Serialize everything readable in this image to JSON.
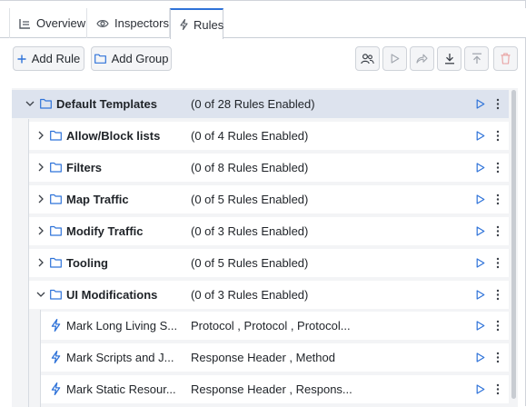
{
  "tabs": [
    {
      "label": "Overview",
      "icon": "table-icon"
    },
    {
      "label": "Inspectors",
      "icon": "eye-icon"
    },
    {
      "label": "Rules",
      "icon": "bolt-icon",
      "active": true
    }
  ],
  "toolbar": {
    "add_rule_label": "Add Rule",
    "add_group_label": "Add Group",
    "icon_buttons": [
      "users-icon",
      "play-icon",
      "share-icon",
      "download-icon",
      "upload-icon",
      "trash-icon"
    ]
  },
  "colors": {
    "accent": "#2f73d9",
    "root_row": "#dde3ee",
    "delete": "#e05555"
  },
  "tree": {
    "root": {
      "name": "Default Templates",
      "summary": "(0 of 28 Rules Enabled)",
      "expanded": true
    },
    "groups": [
      {
        "name": "Allow/Block lists",
        "summary": "(0 of 4 Rules Enabled)",
        "expanded": false
      },
      {
        "name": "Filters",
        "summary": "(0 of 8 Rules Enabled)",
        "expanded": false
      },
      {
        "name": "Map Traffic",
        "summary": "(0 of 5 Rules Enabled)",
        "expanded": false
      },
      {
        "name": "Modify Traffic",
        "summary": "(0 of 3 Rules Enabled)",
        "expanded": false
      },
      {
        "name": "Tooling",
        "summary": "(0 of 5 Rules Enabled)",
        "expanded": false
      },
      {
        "name": "UI Modifications",
        "summary": "(0 of 3 Rules Enabled)",
        "expanded": true
      }
    ],
    "rules": [
      {
        "name": "Mark Long Living S...",
        "summary": "Protocol , Protocol , Protocol..."
      },
      {
        "name": "Mark Scripts and J...",
        "summary": "Response Header , Method"
      },
      {
        "name": "Mark Static Resour...",
        "summary": "Response Header , Respons..."
      }
    ]
  }
}
